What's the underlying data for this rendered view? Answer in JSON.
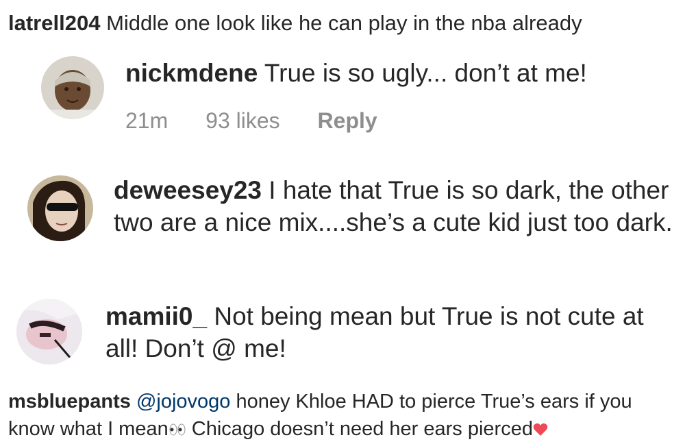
{
  "top_comment": {
    "username": "latrell204",
    "text": "Middle one look like he can play in the nba already"
  },
  "comments": [
    {
      "username": "nickmdene",
      "text": "True is so ugly... don’t at me!",
      "time": "21m",
      "likes": "93 likes",
      "reply": "Reply"
    },
    {
      "username": "deweesey23",
      "text": "I hate that True is so dark, the other two are a nice mix....she’s a cute kid just too dark."
    },
    {
      "username": "mamii0_",
      "text": "Not being mean but True is not cute at all! Don’t @ me!"
    }
  ],
  "bottom_comment": {
    "username": "msbluepants",
    "mention": "@jojovogo",
    "text_part1": "honey Khloe HAD to pierce True’s ears if you know what I mean",
    "text_part2": "Chicago doesn’t need her ears pierced",
    "emoji_1": "eyes-emoji",
    "emoji_2": "red-heart-emoji"
  },
  "colors": {
    "text": "#262626",
    "meta": "#8e8e8e",
    "mention": "#00376b",
    "heart": "#ed4956"
  }
}
